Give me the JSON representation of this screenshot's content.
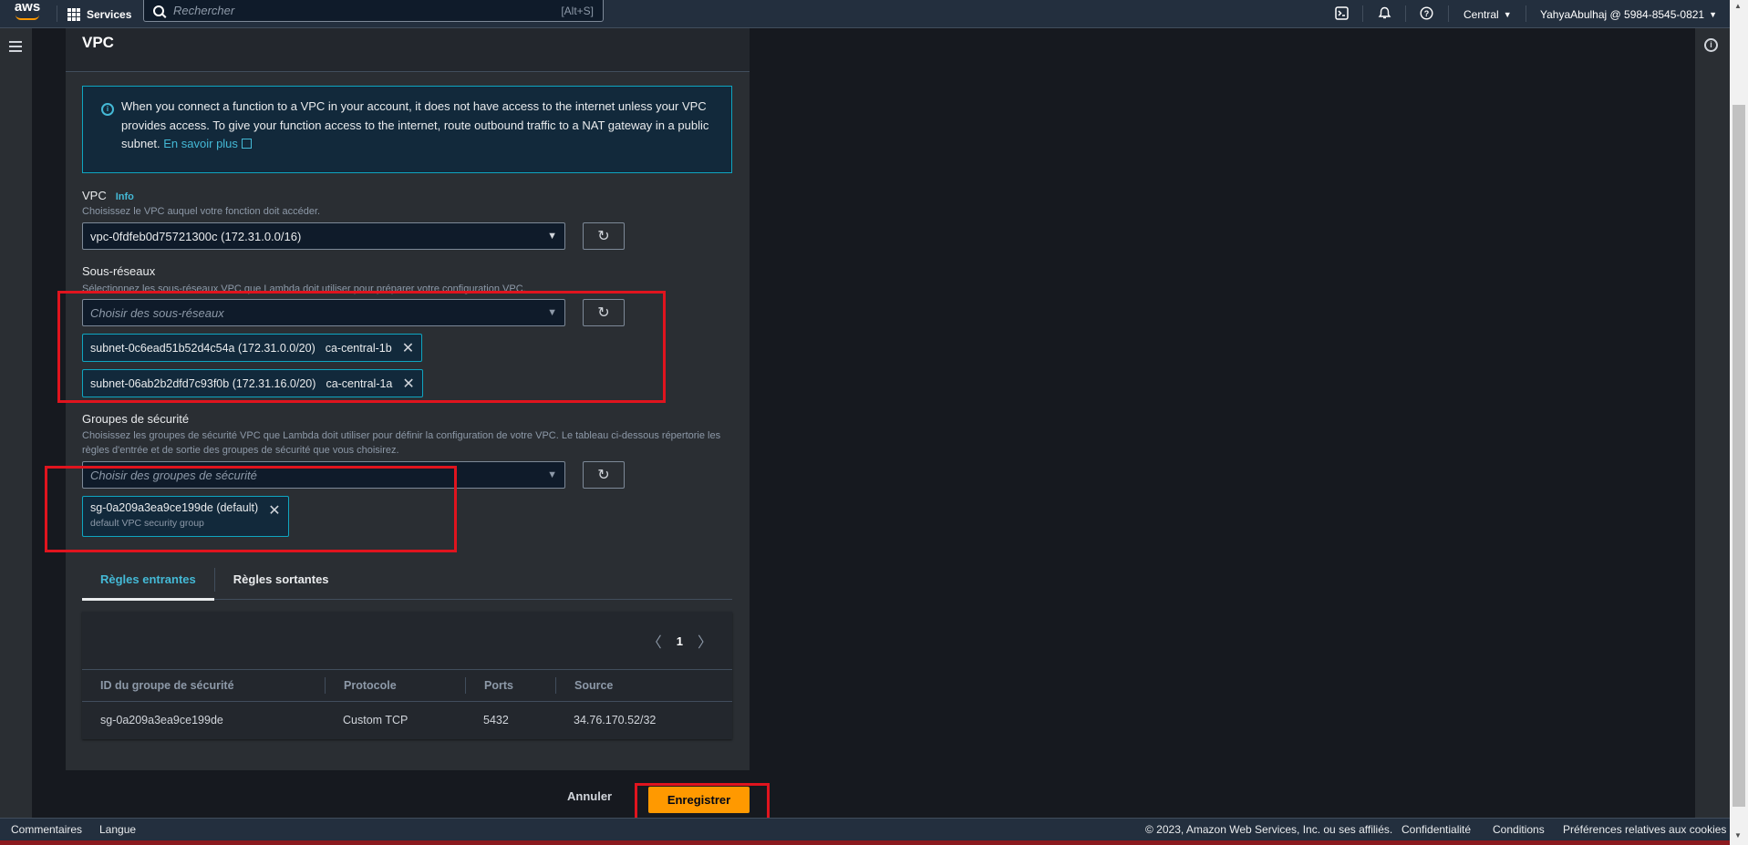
{
  "topbar": {
    "logo": "aws",
    "services_label": "Services",
    "search_placeholder": "Rechercher",
    "search_shortcut": "[Alt+S]",
    "region": "Central",
    "account": "YahyaAbulhaj @ 5984-8545-0821"
  },
  "panel": {
    "title": "VPC",
    "alert": {
      "text": "When you connect a function to a VPC in your account, it does not have access to the internet unless your VPC provides access. To give your function access to the internet, route outbound traffic to a NAT gateway in a public subnet.",
      "link": "En savoir plus"
    },
    "vpc": {
      "label": "VPC",
      "info": "Info",
      "description": "Choisissez le VPC auquel votre fonction doit accéder.",
      "value": "vpc-0fdfeb0d75721300c (172.31.0.0/16)"
    },
    "subnets": {
      "label": "Sous-réseaux",
      "description": "Sélectionnez les sous-réseaux VPC que Lambda doit utiliser pour préparer votre configuration VPC.",
      "placeholder": "Choisir des sous-réseaux",
      "selected": [
        {
          "id": "subnet-0c6ead51b52d4c54a (172.31.0.0/20)",
          "az": "ca-central-1b"
        },
        {
          "id": "subnet-06ab2b2dfd7c93f0b (172.31.16.0/20)",
          "az": "ca-central-1a"
        }
      ]
    },
    "security_groups": {
      "label": "Groupes de sécurité",
      "description": "Choisissez les groupes de sécurité VPC que Lambda doit utiliser pour définir la configuration de votre VPC. Le tableau ci-dessous répertorie les règles d'entrée et de sortie des groupes de sécurité que vous choisirez.",
      "placeholder": "Choisir des groupes de sécurité",
      "selected": [
        {
          "id": "sg-0a209a3ea9ce199de (default)",
          "description": "default VPC security group"
        }
      ]
    },
    "tabs": [
      {
        "label": "Règles entrantes",
        "active": true
      },
      {
        "label": "Règles sortantes",
        "active": false
      }
    ],
    "pagination": {
      "current_page": "1"
    },
    "table": {
      "headers": [
        "ID du groupe de sécurité",
        "Protocole",
        "Ports",
        "Source"
      ],
      "rows": [
        [
          "sg-0a209a3ea9ce199de",
          "Custom TCP",
          "5432",
          "34.76.170.52/32"
        ]
      ]
    }
  },
  "actions": {
    "cancel": "Annuler",
    "save": "Enregistrer"
  },
  "footer": {
    "feedback": "Commentaires",
    "language": "Langue",
    "copyright": "© 2023, Amazon Web Services, Inc. ou ses affiliés.",
    "privacy": "Confidentialité",
    "terms": "Conditions",
    "cookies": "Préférences relatives aux cookies"
  },
  "colors": {
    "accent": "#ff9900",
    "link": "#44b9d6",
    "annotation": "#e0141e"
  }
}
